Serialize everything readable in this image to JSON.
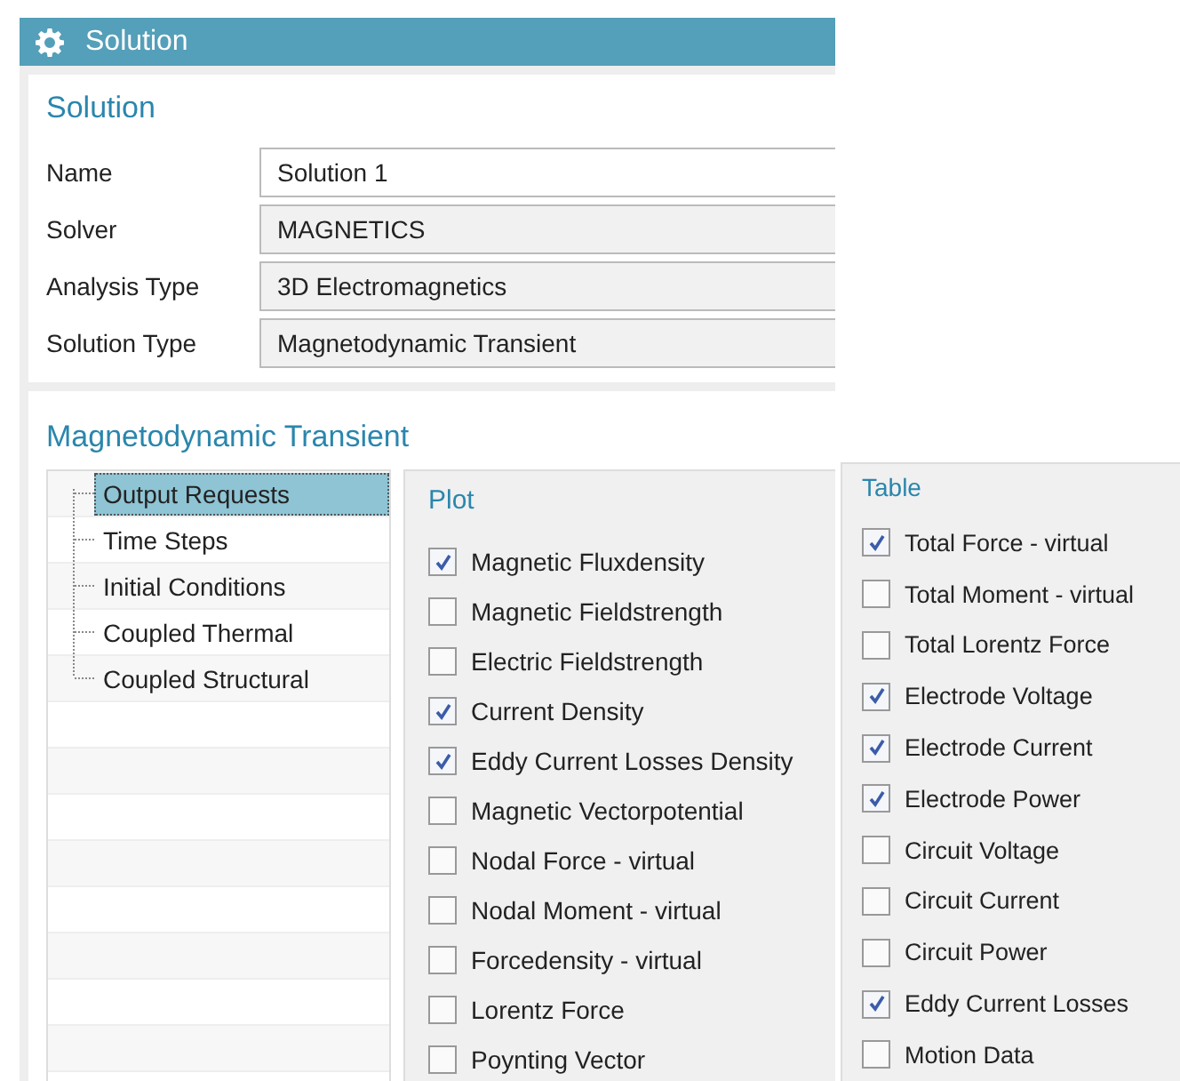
{
  "window": {
    "title": "Solution"
  },
  "solution": {
    "heading": "Solution",
    "fields": [
      {
        "label": "Name",
        "value": "Solution 1",
        "editable": true
      },
      {
        "label": "Solver",
        "value": "MAGNETICS",
        "editable": false
      },
      {
        "label": "Analysis Type",
        "value": "3D Electromagnetics",
        "editable": false
      },
      {
        "label": "Solution Type",
        "value": "Magnetodynamic Transient",
        "editable": false
      }
    ]
  },
  "transient": {
    "heading": "Magnetodynamic Transient",
    "tree": [
      {
        "label": "Output Requests",
        "selected": true
      },
      {
        "label": "Time Steps",
        "selected": false
      },
      {
        "label": "Initial Conditions",
        "selected": false
      },
      {
        "label": "Coupled Thermal",
        "selected": false
      },
      {
        "label": "Coupled Structural",
        "selected": false
      }
    ],
    "plot": {
      "title": "Plot",
      "options": [
        {
          "label": "Magnetic Fluxdensity",
          "checked": true
        },
        {
          "label": "Magnetic Fieldstrength",
          "checked": false
        },
        {
          "label": "Electric Fieldstrength",
          "checked": false
        },
        {
          "label": "Current Density",
          "checked": true
        },
        {
          "label": "Eddy Current Losses Density",
          "checked": true
        },
        {
          "label": "Magnetic Vectorpotential",
          "checked": false
        },
        {
          "label": "Nodal Force - virtual",
          "checked": false
        },
        {
          "label": "Nodal Moment - virtual",
          "checked": false
        },
        {
          "label": "Forcedensity - virtual",
          "checked": false
        },
        {
          "label": "Lorentz Force",
          "checked": false
        },
        {
          "label": "Poynting Vector",
          "checked": false
        }
      ]
    },
    "table": {
      "title": "Table",
      "options": [
        {
          "label": "Total Force - virtual",
          "checked": true
        },
        {
          "label": "Total Moment - virtual",
          "checked": false
        },
        {
          "label": "Total Lorentz Force",
          "checked": false
        },
        {
          "label": "Electrode Voltage",
          "checked": true
        },
        {
          "label": "Electrode Current",
          "checked": true
        },
        {
          "label": "Electrode Power",
          "checked": true
        },
        {
          "label": "Circuit Voltage",
          "checked": false
        },
        {
          "label": "Circuit Current",
          "checked": false
        },
        {
          "label": "Circuit Power",
          "checked": false
        },
        {
          "label": "Eddy Current Losses",
          "checked": true
        },
        {
          "label": "Motion Data",
          "checked": false
        }
      ]
    }
  }
}
